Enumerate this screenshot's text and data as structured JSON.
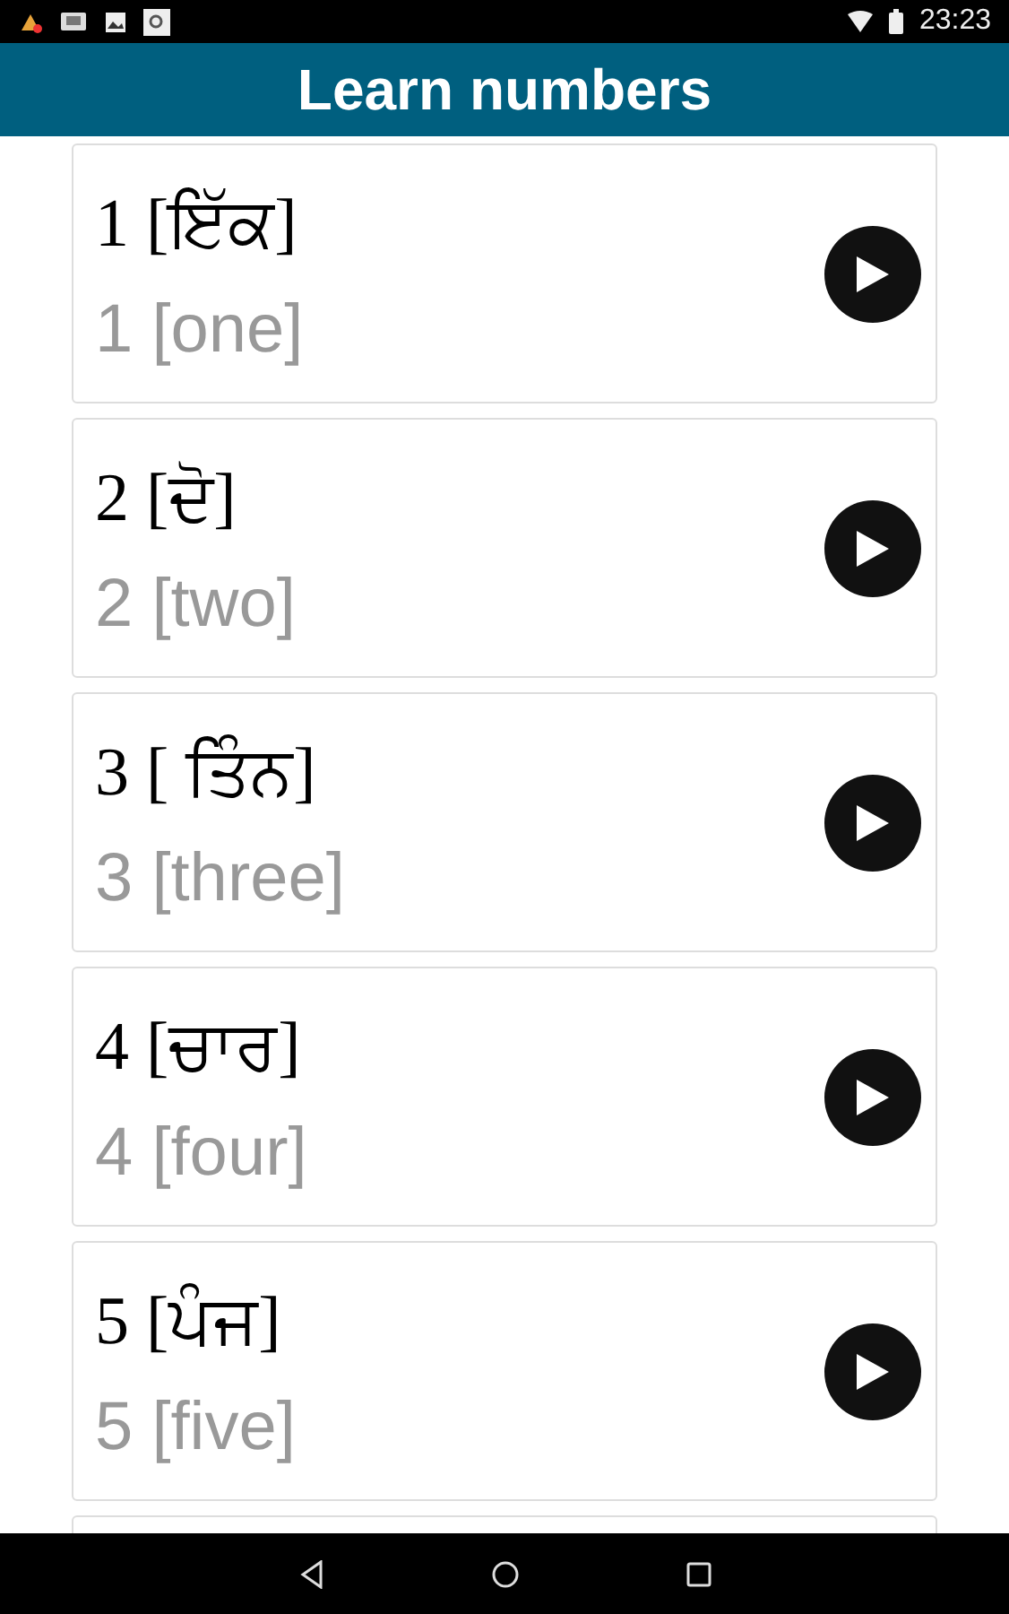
{
  "status_bar": {
    "time": "23:23"
  },
  "app_bar": {
    "title": "Learn numbers"
  },
  "numbers": [
    {
      "native": "1 [ਇੱਕ]",
      "translation": "1 [one]"
    },
    {
      "native": "2 [ਦੋ]",
      "translation": "2 [two]"
    },
    {
      "native": "3 [ ਤਿੰਨ]",
      "translation": "3 [three]"
    },
    {
      "native": "4 [ਚਾਰ]",
      "translation": "4 [four]"
    },
    {
      "native": "5 [ਪੰਜ]",
      "translation": "5 [five]"
    }
  ]
}
